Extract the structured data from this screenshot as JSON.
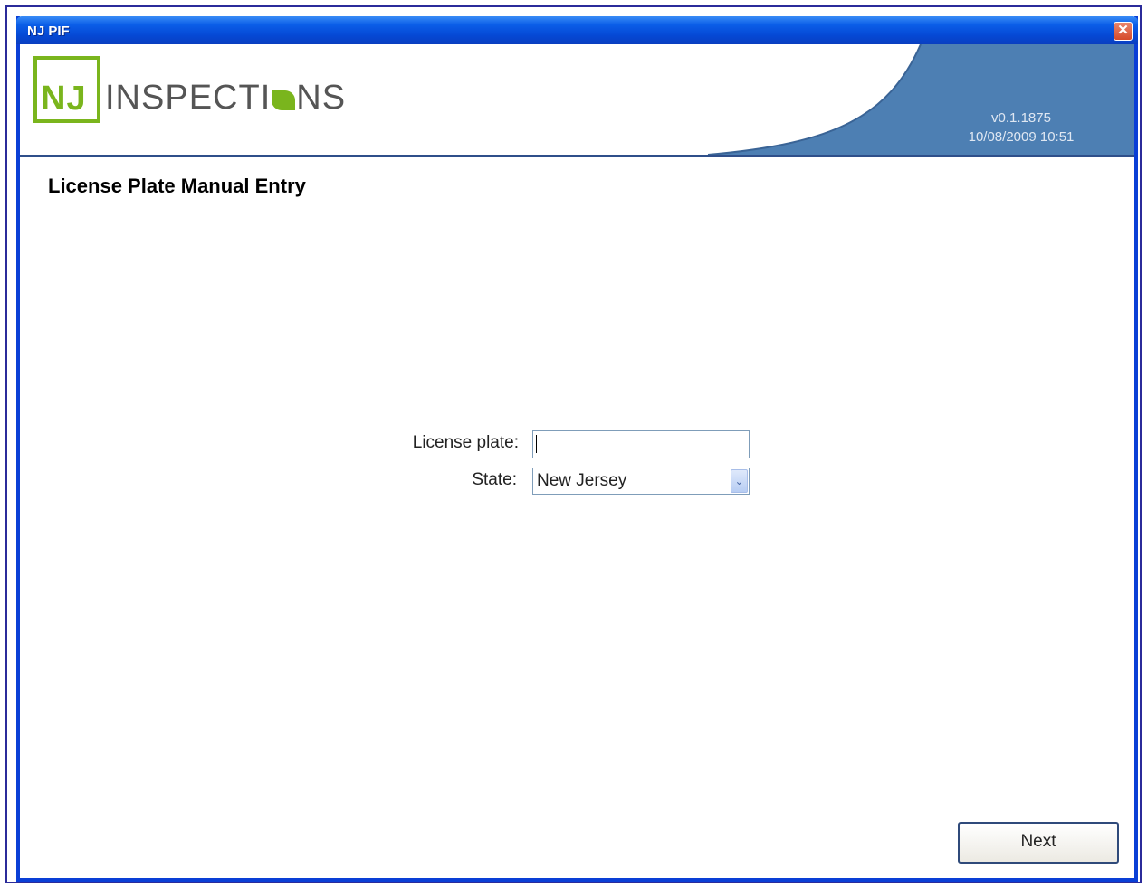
{
  "window": {
    "title": "NJ PIF",
    "close_label": "✕"
  },
  "header": {
    "logo_nj": "NJ",
    "logo_word_pre": "INSPECTI",
    "logo_word_post": "NS",
    "version": "v0.1.1875",
    "timestamp": "10/08/2009 10:51",
    "colors": {
      "brand_green": "#7ab51d",
      "banner_blue": "#4d7fb3",
      "titlebar_blue": "#0548d4"
    }
  },
  "main": {
    "heading": "License Plate Manual Entry",
    "form": {
      "plate_label": "License plate:",
      "plate_value": "",
      "state_label": "State:",
      "state_value": "New Jersey"
    }
  },
  "footer": {
    "next_label": "Next"
  }
}
